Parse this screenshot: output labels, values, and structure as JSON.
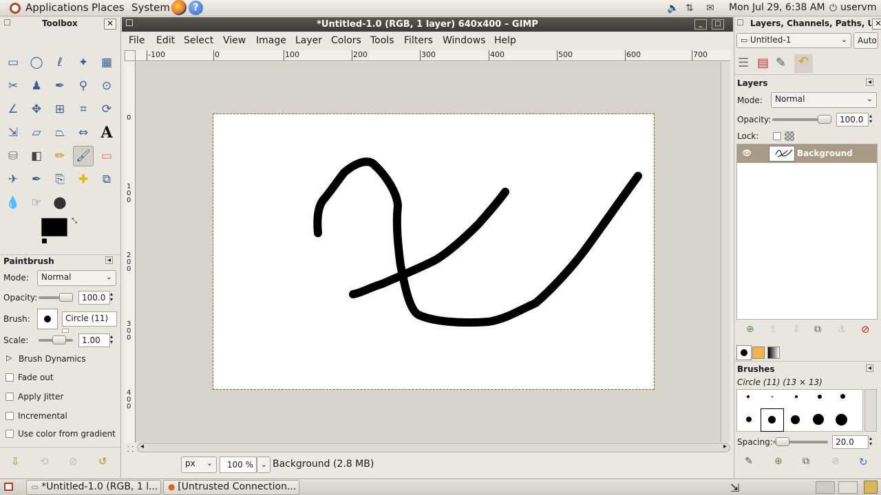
{
  "top_panel": {
    "menus": [
      "Applications",
      "Places",
      "System"
    ],
    "clock": "Mon Jul 29,  6:38 AM",
    "user": "uservm"
  },
  "toolbox": {
    "title": "Toolbox",
    "tools": [
      "rect-select",
      "ellipse-select",
      "free-select",
      "fuzzy-select",
      "color-select",
      "scissors",
      "foreground-select",
      "paths",
      "color-picker",
      "zoom",
      "measure",
      "move",
      "align",
      "crop",
      "rotate",
      "scale",
      "shear",
      "perspective",
      "flip",
      "text",
      "bucket-fill",
      "blend",
      "pencil",
      "paintbrush",
      "eraser",
      "airbrush",
      "ink",
      "clone",
      "heal",
      "perspective-clone",
      "blur",
      "smudge",
      "dodge-burn"
    ],
    "fg_color": "#000000",
    "bg_color": "#ffffff",
    "options": {
      "title": "Paintbrush",
      "mode_label": "Mode:",
      "mode_value": "Normal",
      "opacity_label": "Opacity:",
      "opacity_value": "100.0",
      "brush_label": "Brush:",
      "brush_value": "Circle (11)",
      "scale_label": "Scale:",
      "scale_value": "1.00",
      "brush_dynamics": "Brush Dynamics",
      "fade_out": "Fade out",
      "apply_jitter": "Apply Jitter",
      "incremental": "Incremental",
      "use_gradient": "Use color from gradient"
    }
  },
  "image_window": {
    "title": "*Untitled-1.0 (RGB, 1 layer) 640x400 – GIMP",
    "menu": [
      "File",
      "Edit",
      "Select",
      "View",
      "Image",
      "Layer",
      "Colors",
      "Tools",
      "Filters",
      "Windows",
      "Help"
    ],
    "ruler_h": [
      "-100",
      "0",
      "100",
      "200",
      "300",
      "400",
      "500",
      "600",
      "700"
    ],
    "ruler_v": [
      "0",
      "1 0 0",
      "2 0 0",
      "3 0 0",
      "4 0 0"
    ],
    "unit": "px",
    "zoom": "100 %",
    "status": "Background (2.8 MB)"
  },
  "right_dock": {
    "title": "Layers, Channels, Paths, U",
    "image_select": "Untitled-1",
    "auto": "Auto",
    "layers_title": "Layers",
    "mode_label": "Mode:",
    "mode_value": "Normal",
    "opacity_label": "Opacity:",
    "opacity_value": "100.0",
    "lock_label": "Lock:",
    "layer_name": "Background",
    "brushes_title": "Brushes",
    "brush_info": "Circle (11) (13 × 13)",
    "spacing_label": "Spacing:",
    "spacing_value": "20.0"
  },
  "taskbar": {
    "items": [
      "*Untitled-1.0 (RGB, 1 l...",
      "[Untrusted Connection..."
    ]
  }
}
